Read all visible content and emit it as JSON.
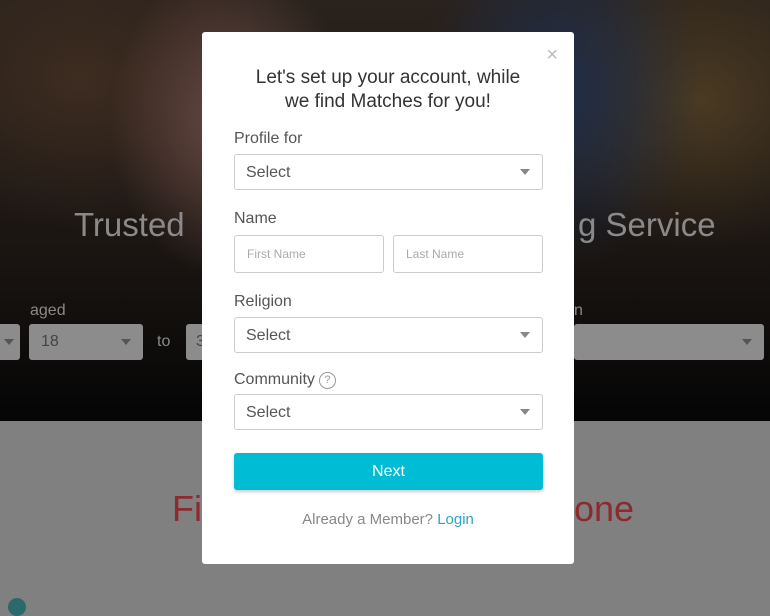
{
  "background": {
    "hero_title_left": "Trusted",
    "hero_title_right": "g Service",
    "aged_label": "aged",
    "age_from": "18",
    "to_label": "to",
    "age_to_partial": "3",
    "right_label_partial": "n",
    "bottom_title_left": "Fi",
    "bottom_title_right": "one"
  },
  "modal": {
    "close_icon": "×",
    "title_line1": "Let's set up your account, while",
    "title_line2": "we find Matches for you!",
    "profile_for_label": "Profile for",
    "profile_for_value": "Select",
    "name_label": "Name",
    "first_name_placeholder": "First Name",
    "last_name_placeholder": "Last Name",
    "religion_label": "Religion",
    "religion_value": "Select",
    "community_label": "Community",
    "community_help": "?",
    "community_value": "Select",
    "next_label": "Next",
    "member_text": "Already a Member?",
    "login_label": "Login"
  },
  "colors": {
    "accent": "#00bcd5",
    "link": "#2aa6c4",
    "overlay": "#808080"
  }
}
